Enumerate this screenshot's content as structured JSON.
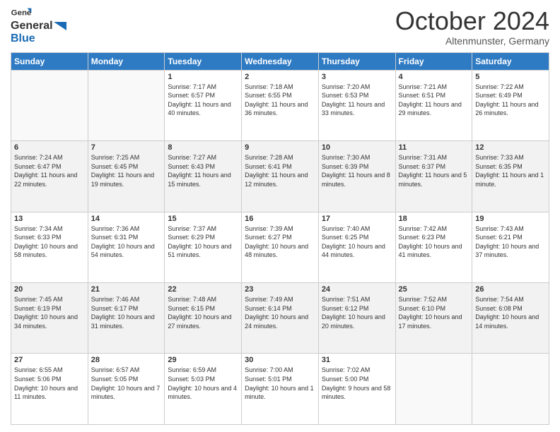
{
  "header": {
    "logo_general": "General",
    "logo_blue": "Blue",
    "month_title": "October 2024",
    "subtitle": "Altenmunster, Germany"
  },
  "days_of_week": [
    "Sunday",
    "Monday",
    "Tuesday",
    "Wednesday",
    "Thursday",
    "Friday",
    "Saturday"
  ],
  "weeks": [
    [
      {
        "day": "",
        "info": ""
      },
      {
        "day": "",
        "info": ""
      },
      {
        "day": "1",
        "info": "Sunrise: 7:17 AM\nSunset: 6:57 PM\nDaylight: 11 hours and 40 minutes."
      },
      {
        "day": "2",
        "info": "Sunrise: 7:18 AM\nSunset: 6:55 PM\nDaylight: 11 hours and 36 minutes."
      },
      {
        "day": "3",
        "info": "Sunrise: 7:20 AM\nSunset: 6:53 PM\nDaylight: 11 hours and 33 minutes."
      },
      {
        "day": "4",
        "info": "Sunrise: 7:21 AM\nSunset: 6:51 PM\nDaylight: 11 hours and 29 minutes."
      },
      {
        "day": "5",
        "info": "Sunrise: 7:22 AM\nSunset: 6:49 PM\nDaylight: 11 hours and 26 minutes."
      }
    ],
    [
      {
        "day": "6",
        "info": "Sunrise: 7:24 AM\nSunset: 6:47 PM\nDaylight: 11 hours and 22 minutes."
      },
      {
        "day": "7",
        "info": "Sunrise: 7:25 AM\nSunset: 6:45 PM\nDaylight: 11 hours and 19 minutes."
      },
      {
        "day": "8",
        "info": "Sunrise: 7:27 AM\nSunset: 6:43 PM\nDaylight: 11 hours and 15 minutes."
      },
      {
        "day": "9",
        "info": "Sunrise: 7:28 AM\nSunset: 6:41 PM\nDaylight: 11 hours and 12 minutes."
      },
      {
        "day": "10",
        "info": "Sunrise: 7:30 AM\nSunset: 6:39 PM\nDaylight: 11 hours and 8 minutes."
      },
      {
        "day": "11",
        "info": "Sunrise: 7:31 AM\nSunset: 6:37 PM\nDaylight: 11 hours and 5 minutes."
      },
      {
        "day": "12",
        "info": "Sunrise: 7:33 AM\nSunset: 6:35 PM\nDaylight: 11 hours and 1 minute."
      }
    ],
    [
      {
        "day": "13",
        "info": "Sunrise: 7:34 AM\nSunset: 6:33 PM\nDaylight: 10 hours and 58 minutes."
      },
      {
        "day": "14",
        "info": "Sunrise: 7:36 AM\nSunset: 6:31 PM\nDaylight: 10 hours and 54 minutes."
      },
      {
        "day": "15",
        "info": "Sunrise: 7:37 AM\nSunset: 6:29 PM\nDaylight: 10 hours and 51 minutes."
      },
      {
        "day": "16",
        "info": "Sunrise: 7:39 AM\nSunset: 6:27 PM\nDaylight: 10 hours and 48 minutes."
      },
      {
        "day": "17",
        "info": "Sunrise: 7:40 AM\nSunset: 6:25 PM\nDaylight: 10 hours and 44 minutes."
      },
      {
        "day": "18",
        "info": "Sunrise: 7:42 AM\nSunset: 6:23 PM\nDaylight: 10 hours and 41 minutes."
      },
      {
        "day": "19",
        "info": "Sunrise: 7:43 AM\nSunset: 6:21 PM\nDaylight: 10 hours and 37 minutes."
      }
    ],
    [
      {
        "day": "20",
        "info": "Sunrise: 7:45 AM\nSunset: 6:19 PM\nDaylight: 10 hours and 34 minutes."
      },
      {
        "day": "21",
        "info": "Sunrise: 7:46 AM\nSunset: 6:17 PM\nDaylight: 10 hours and 31 minutes."
      },
      {
        "day": "22",
        "info": "Sunrise: 7:48 AM\nSunset: 6:15 PM\nDaylight: 10 hours and 27 minutes."
      },
      {
        "day": "23",
        "info": "Sunrise: 7:49 AM\nSunset: 6:14 PM\nDaylight: 10 hours and 24 minutes."
      },
      {
        "day": "24",
        "info": "Sunrise: 7:51 AM\nSunset: 6:12 PM\nDaylight: 10 hours and 20 minutes."
      },
      {
        "day": "25",
        "info": "Sunrise: 7:52 AM\nSunset: 6:10 PM\nDaylight: 10 hours and 17 minutes."
      },
      {
        "day": "26",
        "info": "Sunrise: 7:54 AM\nSunset: 6:08 PM\nDaylight: 10 hours and 14 minutes."
      }
    ],
    [
      {
        "day": "27",
        "info": "Sunrise: 6:55 AM\nSunset: 5:06 PM\nDaylight: 10 hours and 11 minutes."
      },
      {
        "day": "28",
        "info": "Sunrise: 6:57 AM\nSunset: 5:05 PM\nDaylight: 10 hours and 7 minutes."
      },
      {
        "day": "29",
        "info": "Sunrise: 6:59 AM\nSunset: 5:03 PM\nDaylight: 10 hours and 4 minutes."
      },
      {
        "day": "30",
        "info": "Sunrise: 7:00 AM\nSunset: 5:01 PM\nDaylight: 10 hours and 1 minute."
      },
      {
        "day": "31",
        "info": "Sunrise: 7:02 AM\nSunset: 5:00 PM\nDaylight: 9 hours and 58 minutes."
      },
      {
        "day": "",
        "info": ""
      },
      {
        "day": "",
        "info": ""
      }
    ]
  ]
}
